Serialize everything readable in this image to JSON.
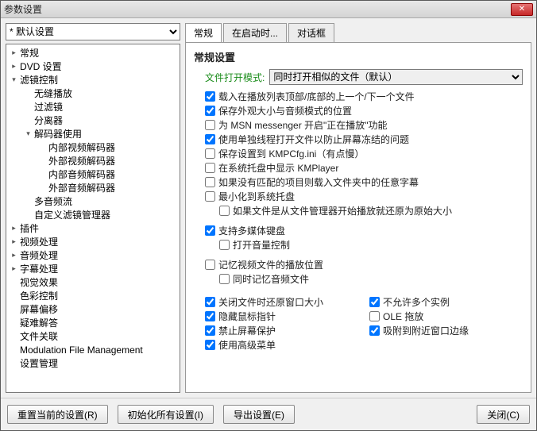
{
  "window": {
    "title": "参数设置"
  },
  "combo": {
    "value": "* 默认设置"
  },
  "tree": [
    {
      "label": "常规",
      "depth": 0,
      "exp": "closed"
    },
    {
      "label": "DVD 设置",
      "depth": 0,
      "exp": "closed"
    },
    {
      "label": "滤镜控制",
      "depth": 0,
      "exp": "open"
    },
    {
      "label": "无缝播放",
      "depth": 1,
      "exp": "leaf"
    },
    {
      "label": "过滤镜",
      "depth": 1,
      "exp": "leaf"
    },
    {
      "label": "分离器",
      "depth": 1,
      "exp": "leaf"
    },
    {
      "label": "解码器使用",
      "depth": 1,
      "exp": "open"
    },
    {
      "label": "内部视频解码器",
      "depth": 2,
      "exp": "leaf"
    },
    {
      "label": "外部视频解码器",
      "depth": 2,
      "exp": "leaf"
    },
    {
      "label": "内部音频解码器",
      "depth": 2,
      "exp": "leaf"
    },
    {
      "label": "外部音频解码器",
      "depth": 2,
      "exp": "leaf"
    },
    {
      "label": "多音频流",
      "depth": 1,
      "exp": "leaf"
    },
    {
      "label": "自定义滤镜管理器",
      "depth": 1,
      "exp": "leaf"
    },
    {
      "label": "插件",
      "depth": 0,
      "exp": "closed"
    },
    {
      "label": "视频处理",
      "depth": 0,
      "exp": "closed"
    },
    {
      "label": "音频处理",
      "depth": 0,
      "exp": "closed"
    },
    {
      "label": "字幕处理",
      "depth": 0,
      "exp": "closed"
    },
    {
      "label": "视觉效果",
      "depth": 0,
      "exp": "leaf"
    },
    {
      "label": "色彩控制",
      "depth": 0,
      "exp": "leaf"
    },
    {
      "label": "屏幕偏移",
      "depth": 0,
      "exp": "leaf"
    },
    {
      "label": "疑难解答",
      "depth": 0,
      "exp": "leaf"
    },
    {
      "label": "文件关联",
      "depth": 0,
      "exp": "leaf"
    },
    {
      "label": "Modulation File Management",
      "depth": 0,
      "exp": "leaf"
    },
    {
      "label": "设置管理",
      "depth": 0,
      "exp": "leaf"
    }
  ],
  "tabs": [
    {
      "label": "常规",
      "id": "general"
    },
    {
      "label": "在启动时...",
      "id": "startup"
    },
    {
      "label": "对话框",
      "id": "dialog"
    }
  ],
  "pane": {
    "heading": "常规设置",
    "openModeLabel": "文件打开模式:",
    "openModeValue": "同时打开相似的文件（默认）",
    "checks": [
      {
        "text": "载入在播放列表顶部/底部的上一个/下一个文件",
        "checked": true
      },
      {
        "text": "保存外观大小与音频模式的位置",
        "checked": true
      },
      {
        "text": "为 MSN messenger 开启\"正在播放\"功能",
        "checked": false
      },
      {
        "text": "使用单独线程打开文件以防止屏幕冻结的问题",
        "checked": true
      },
      {
        "text": "保存设置到 KMPCfg.ini（有点慢）",
        "checked": false
      },
      {
        "text": "在系统托盘中显示 KMPlayer",
        "checked": false
      },
      {
        "text": "如果没有匹配的项目则载入文件夹中的任意字幕",
        "checked": false
      },
      {
        "text": "最小化到系统托盘",
        "checked": false
      },
      {
        "text": "如果文件是从文件管理器开始播放就还原为原始大小",
        "checked": false,
        "indent": true
      }
    ],
    "group2": [
      {
        "text": "支持多媒体键盘",
        "checked": true
      },
      {
        "text": "打开音量控制",
        "checked": false,
        "indent": true
      }
    ],
    "group3": [
      {
        "text": "记忆视频文件的播放位置",
        "checked": false
      },
      {
        "text": "同时记忆音频文件",
        "checked": false,
        "indent": true
      }
    ],
    "colsLeft": [
      {
        "text": "关闭文件时还原窗口大小",
        "checked": true
      },
      {
        "text": "隐藏鼠标指针",
        "checked": true
      },
      {
        "text": "禁止屏幕保护",
        "checked": true
      },
      {
        "text": "使用高级菜单",
        "checked": true
      }
    ],
    "colsRight": [
      {
        "text": "不允许多个实例",
        "checked": true
      },
      {
        "text": "OLE 拖放",
        "checked": false
      },
      {
        "text": "吸附到附近窗口边缘",
        "checked": true
      }
    ]
  },
  "footer": {
    "reset": "重置当前的设置(R)",
    "init": "初始化所有设置(I)",
    "export": "导出设置(E)",
    "close": "关闭(C)"
  }
}
